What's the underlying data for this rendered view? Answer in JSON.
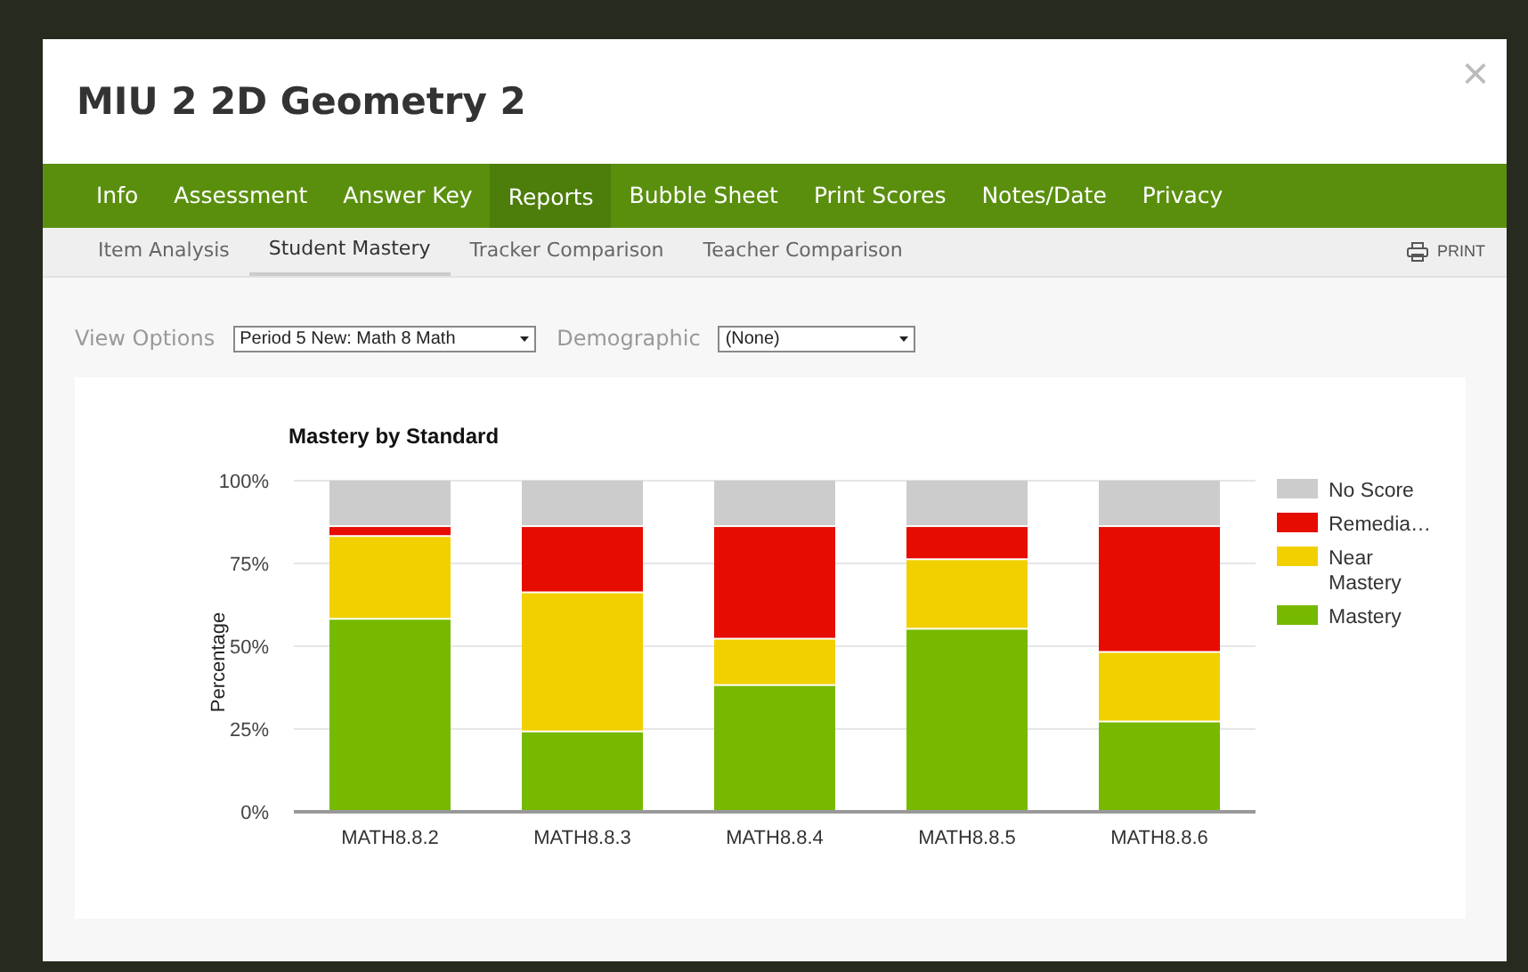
{
  "dialog": {
    "title": "MIU 2 2D Geometry 2",
    "close": "×"
  },
  "tabs": [
    {
      "label": "Info",
      "selected": false
    },
    {
      "label": "Assessment",
      "selected": false
    },
    {
      "label": "Answer Key",
      "selected": false
    },
    {
      "label": "Reports",
      "selected": true
    },
    {
      "label": "Bubble Sheet",
      "selected": false
    },
    {
      "label": "Print Scores",
      "selected": false
    },
    {
      "label": "Notes/Date",
      "selected": false
    },
    {
      "label": "Privacy",
      "selected": false
    }
  ],
  "subtabs": [
    {
      "label": "Item Analysis",
      "selected": false
    },
    {
      "label": "Student Mastery",
      "selected": true
    },
    {
      "label": "Tracker Comparison",
      "selected": false
    },
    {
      "label": "Teacher Comparison",
      "selected": false
    }
  ],
  "print": "PRINT",
  "options": [
    {
      "label": "View Options",
      "value": "Period 5 New: Math 8 Math"
    },
    {
      "label": "Demographic",
      "value": "(None)"
    }
  ],
  "chart": {
    "chart_data": {
      "type": "bar",
      "title": "Mastery by Standard",
      "ylabel": "Percentage",
      "stacked": true,
      "grid": true,
      "legend": true,
      "categories": [
        "MATH8.8.2",
        "MATH8.8.3",
        "MATH8.8.4",
        "MATH8.8.5",
        "MATH8.8.6"
      ],
      "yticks": [
        {
          "value": 0,
          "label": "0%"
        },
        {
          "value": 25,
          "label": "25%"
        },
        {
          "value": 50,
          "label": "50%"
        },
        {
          "value": 75,
          "label": "75%"
        },
        {
          "value": 100,
          "label": "100%"
        }
      ],
      "ylim": [
        0,
        100
      ],
      "series": [
        {
          "name": "Mastery",
          "color": "#76b900",
          "values": [
            58,
            24,
            38,
            55,
            27
          ]
        },
        {
          "name": "Near Mastery",
          "color": "#f2d000",
          "values": [
            25,
            42,
            14,
            21,
            21
          ]
        },
        {
          "name": "Remedia…",
          "color": "#e60c00",
          "values": [
            3,
            20,
            34,
            10,
            38
          ]
        },
        {
          "name": "No Score",
          "color": "#cccccc",
          "values": [
            14,
            14,
            14,
            14,
            14
          ]
        }
      ]
    }
  }
}
